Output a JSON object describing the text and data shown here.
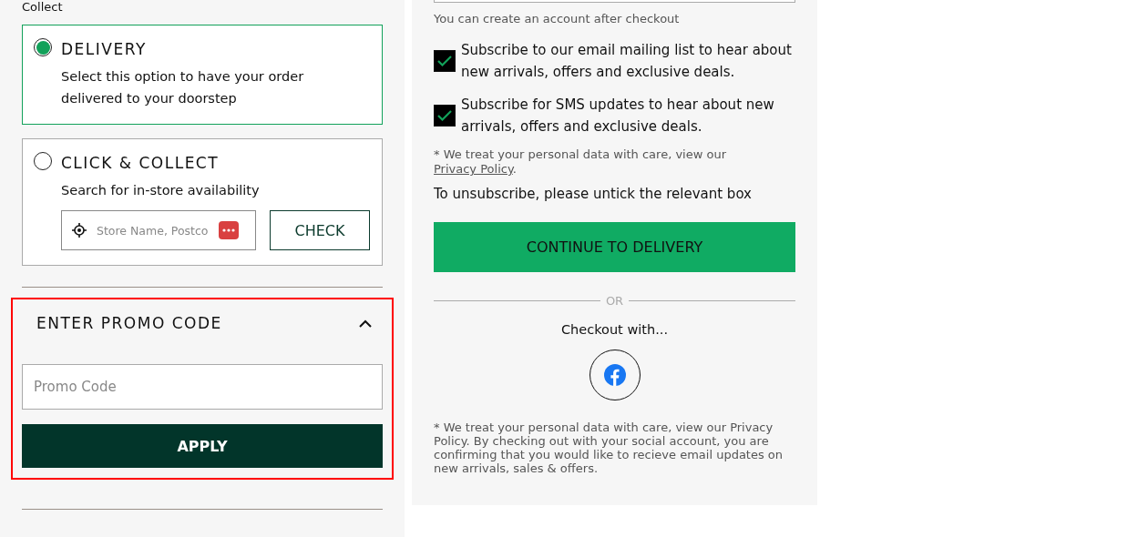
{
  "section_heading": "Collect",
  "delivery_options": [
    {
      "title": "DELIVERY",
      "description": "Select this option to have your order delivered to your doorstep",
      "selected": true
    },
    {
      "title": "CLICK & COLLECT",
      "description": "Search for in-store availability",
      "selected": false,
      "store_search": {
        "placeholder": "Store Name, Postco",
        "button": "CHECK"
      }
    }
  ],
  "promo": {
    "title": "ENTER PROMO CODE",
    "expanded": true,
    "placeholder": "Promo Code",
    "button": "APPLY"
  },
  "account_note": "You can create an account after checkout",
  "subscriptions": [
    {
      "label": "Subscribe to our email mailing list to hear about new arrivals, offers and exclusive deals.",
      "checked": true
    },
    {
      "label": "Subscribe for SMS updates to hear about new arrivals, offers and exclusive deals.",
      "checked": true
    }
  ],
  "privacy_note": {
    "text": "* We treat your personal data with care, view our ",
    "link": "Privacy Policy",
    "end": "."
  },
  "unsubscribe_note": "To unsubscribe, please untick the relevant box",
  "continue_button": "CONTINUE TO DELIVERY",
  "divider_label": "OR",
  "social_heading": "Checkout with...",
  "social_disclaimer": "* We treat your personal data with care, view our Privacy Policy. By checking out with your social account, you are confirming that you would like to recieve email updates on new arrivals, sales & offers."
}
